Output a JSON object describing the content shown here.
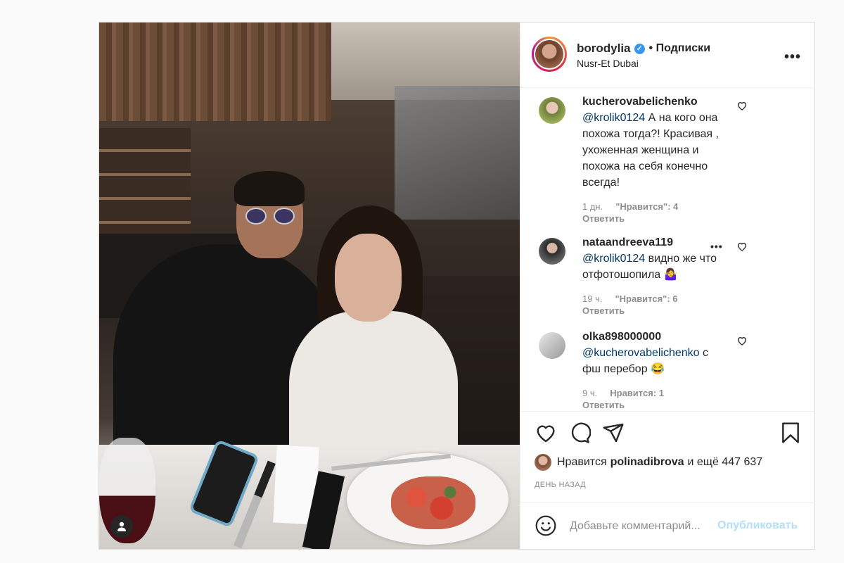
{
  "header": {
    "username": "borodylia",
    "verified_mark": "✓",
    "follow_label": "• Подписки",
    "location": "Nusr-Et Dubai",
    "more_label": "•••"
  },
  "comments": [
    {
      "user": "kucherovabelichenko",
      "mention": "@krolik0124",
      "text": " А на кого она похожа тогда?! Красивая , ухоженная женщина и похожа на себя конечно всегда!",
      "time": "1 дн.",
      "likes": "\"Нравится\": 4",
      "reply": "Ответить"
    },
    {
      "user": "nataandreeva119",
      "mention": "@krolik0124",
      "text": " видно же что отфотошопила 🤷‍♀️",
      "time": "19 ч.",
      "likes": "\"Нравится\": 6",
      "reply": "Ответить",
      "more": "•••"
    },
    {
      "user": "olka898000000",
      "mention": "@kucherovabelichenko",
      "text": " с фш перебор 😂",
      "time": "9 ч.",
      "likes": "Нравится: 1",
      "reply": "Ответить"
    }
  ],
  "actions": {
    "likes_prefix": "Нравится",
    "liked_by": "polinadibrova",
    "likes_suffix": "и ещё 447 637",
    "posted": "ДЕНЬ НАЗАД"
  },
  "add_comment": {
    "placeholder": "Добавьте комментарий...",
    "publish_label": "Опубликовать"
  },
  "icons": [
    "heart-icon",
    "comment-icon",
    "share-icon",
    "bookmark-icon",
    "emoji-icon",
    "user-tag-icon",
    "verified-icon",
    "more-icon"
  ],
  "colors": {
    "link": "#00376b",
    "verified": "#3897f0",
    "publish_disabled": "#b2dffc",
    "muted": "#8e8e8e"
  }
}
